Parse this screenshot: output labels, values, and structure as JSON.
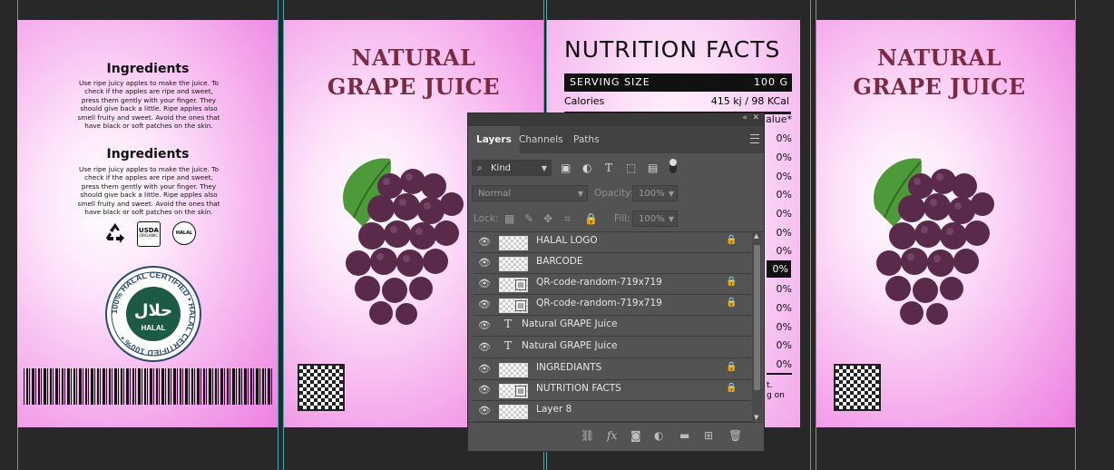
{
  "left_panel": {
    "ingredients_1_title": "Ingredients",
    "ingredients_1_text": "Use ripe juicy apples to make the juice. To check if the apples are ripe and sweet, press them gently with your finger. They should give back a little. Ripe apples also smell fruity and sweet. Avoid the ones that have black or soft patches on the skin.",
    "ingredients_2_title": "Ingredients",
    "ingredients_2_text": "Use ripe juicy apples to make the juice. To check if the apples are ripe and sweet, press them gently with your finger. They should give back a little. Ripe apples also smell fruity and sweet. Avoid the ones that have black or soft patches on the skin.",
    "usda_label": "USDA",
    "usda_sub": "ORGANIC",
    "halal_small": "HALAL",
    "seal_ring_text": "100% HALAL CERTIFIED • HALAL CERTIFIED 100% •",
    "seal_center": "حلال",
    "seal_label": "HALAL"
  },
  "front_panel": {
    "title_line1": "NATURAL",
    "title_line2": "GRAPE JUICE"
  },
  "nutrition": {
    "title": "NUTRITION FACTS",
    "serving_label": "SERVING SIZE",
    "serving_value": "100 G",
    "calories_label": "Calories",
    "calories_value": "415 kj / 98 KCal",
    "dv_header_partial": "alue*",
    "percents": [
      "0%",
      "0%",
      "0%",
      "0%",
      "0%",
      "0%",
      "0%",
      "0%",
      "0%",
      "0%",
      "0%",
      "0%",
      "0%"
    ],
    "footnote_line1": "t.",
    "footnote_line2": "g on"
  },
  "right_panel": {
    "title_line1": "NATURAL",
    "title_line2": "GRAPE JUICE"
  },
  "layers_panel": {
    "tabs": [
      "Layers",
      "Channels",
      "Paths"
    ],
    "active_tab": "Layers",
    "filter_kind": "Kind",
    "blend_mode": "Normal",
    "opacity_label": "Opacity:",
    "opacity_value": "100%",
    "lock_label": "Lock:",
    "fill_label": "Fill:",
    "fill_value": "100%",
    "layers": [
      {
        "name": "HALAL LOGO",
        "type": "pixel",
        "locked": true
      },
      {
        "name": "BARCODE",
        "type": "pixel",
        "locked": false
      },
      {
        "name": "QR-code-random-719x719",
        "type": "smart",
        "locked": true
      },
      {
        "name": "QR-code-random-719x719",
        "type": "smart",
        "locked": true
      },
      {
        "name": "Natural  GRAPE Juice",
        "type": "text",
        "locked": false
      },
      {
        "name": "Natural  GRAPE Juice",
        "type": "text",
        "locked": false
      },
      {
        "name": "INGREDIANTS",
        "type": "pixel",
        "locked": true
      },
      {
        "name": "NUTRITION FACTS",
        "type": "smart",
        "locked": true
      },
      {
        "name": "Layer 8",
        "type": "pixel",
        "locked": false
      }
    ]
  },
  "colors": {
    "canvas_bg": "#282828",
    "guide": "#4fd6dc",
    "title_color": "#7a2a42",
    "panel_bg": "#535353",
    "seal_green": "#1d5a45"
  }
}
